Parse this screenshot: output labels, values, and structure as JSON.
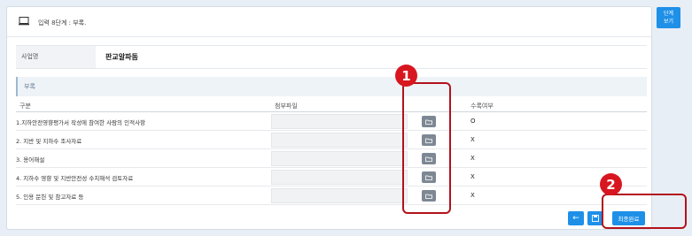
{
  "header": {
    "title": "입력 8단계 : 부록."
  },
  "business": {
    "label": "사업명",
    "value": "판교알파돔"
  },
  "section": {
    "title": "부록"
  },
  "table": {
    "headers": [
      "구분",
      "첨부파일",
      "수록여부"
    ],
    "rows": [
      {
        "name": "1.지하안전영향평가서 작성에 참여한 사람의 인적사항",
        "status": "O"
      },
      {
        "name": "2. 지반 및 지하수 조사자료",
        "status": "X"
      },
      {
        "name": "3. 용어해설",
        "status": "X"
      },
      {
        "name": "4. 지하수 영향 및 지반안전성 수치해석 검토자료",
        "status": "X"
      },
      {
        "name": "5. 인용 문헌 및 참고자료 등",
        "status": "X"
      }
    ]
  },
  "footer": {
    "prev_label": "←",
    "final_label": "최종완료"
  },
  "side": {
    "line1": "단계",
    "line2": "보기"
  },
  "annotations": [
    {
      "label": "1"
    },
    {
      "label": "2"
    }
  ],
  "colors": {
    "accent": "#1e90e8",
    "highlight": "#b3121b",
    "badge": "#d8161f",
    "file_button": "#7d8894"
  }
}
